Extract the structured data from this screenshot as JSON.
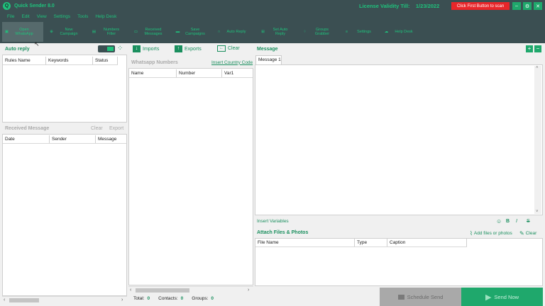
{
  "title": {
    "logo_letter": "Q",
    "app_name": "Quick Sender 8.0",
    "license": "License Validity Till:    1/23/2022",
    "scan_label": "Click First Button to scan"
  },
  "menu": [
    "File",
    "Edit",
    "View",
    "Settings",
    "Tools",
    "Help Desk"
  ],
  "toolbar": [
    {
      "label": "Open\nWhatsApp",
      "icon": "whatsapp-scan-icon"
    },
    {
      "label": "New\nCampaign",
      "icon": "plus-circle-icon"
    },
    {
      "label": "Numbers\nFilter",
      "icon": "filter-icon"
    },
    {
      "label": "Received\nMessages",
      "icon": "monitor-icon"
    },
    {
      "label": "Save\nCampaigns",
      "icon": "chat-icon"
    },
    {
      "label": "Auto Reply",
      "icon": "headset-icon"
    },
    {
      "label": "Set Auto\nReply",
      "icon": "network-icon"
    },
    {
      "label": "Groups\nGrabber",
      "icon": "grid-icon"
    },
    {
      "label": "Settings",
      "icon": "settings-icon"
    },
    {
      "label": "Help Desk",
      "icon": "cloud-icon"
    }
  ],
  "auto_reply": {
    "title": "Auto reply",
    "columns": [
      "Rules Name",
      "Keywords",
      "Status"
    ]
  },
  "received": {
    "title": "Received Message",
    "clear": "Clear",
    "export": "Export",
    "columns": [
      "Date",
      "Sender",
      "Message"
    ]
  },
  "numbers": {
    "imports": "Imports",
    "exports": "Exports",
    "clear": "Clear",
    "title": "Whatsapp Numbers",
    "insert_code": "Insert Country Code",
    "columns": [
      "Name",
      "Number",
      "Var1"
    ],
    "stats": {
      "total_label": "Total:",
      "total": "0",
      "contacts_label": "Contacts:",
      "contacts": "0",
      "groups_label": "Groups:",
      "groups": "0"
    }
  },
  "message": {
    "title": "Message",
    "tab": "Message 1",
    "insert_variables": "Insert Variables",
    "bold": "B",
    "italic": "I",
    "strike": "S"
  },
  "attach": {
    "title": "Attach Files & Photos",
    "add": "Add files or photos",
    "clear": "Clear",
    "columns": [
      "File Name",
      "Type",
      "Caption"
    ]
  },
  "footer": {
    "schedule": "Schedule Send",
    "send": "Send Now"
  },
  "colors": {
    "dark": "#3b4f52",
    "accent": "#1fc27c",
    "red": "#e8262a",
    "send": "#1fa86c"
  }
}
